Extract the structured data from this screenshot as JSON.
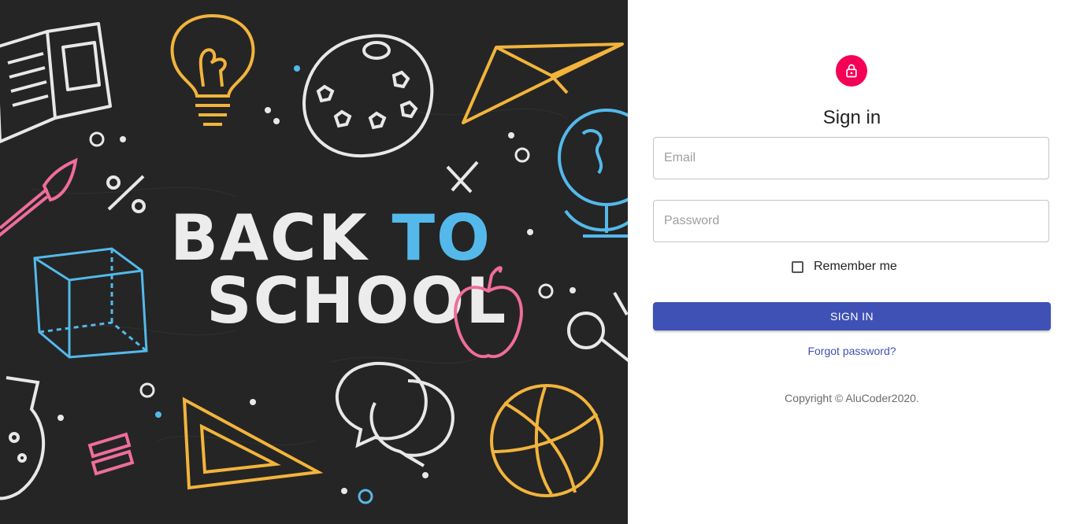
{
  "hero": {
    "heading_line1_part1": "BACK ",
    "heading_line1_part2": "TO",
    "heading_line2": "SCHOOL",
    "background_color": "#252525",
    "accent_color": "#54b9ea"
  },
  "signin": {
    "icon": "lock-icon",
    "icon_bg_color": "#f50057",
    "title": "Sign in",
    "email_placeholder": "Email",
    "password_placeholder": "Password",
    "remember_label": "Remember me",
    "remember_checked": false,
    "submit_label": "SIGN IN",
    "submit_color": "#3f51b5",
    "forgot_link": "Forgot password?",
    "copyright": "Copyright © AluCoder2020."
  }
}
